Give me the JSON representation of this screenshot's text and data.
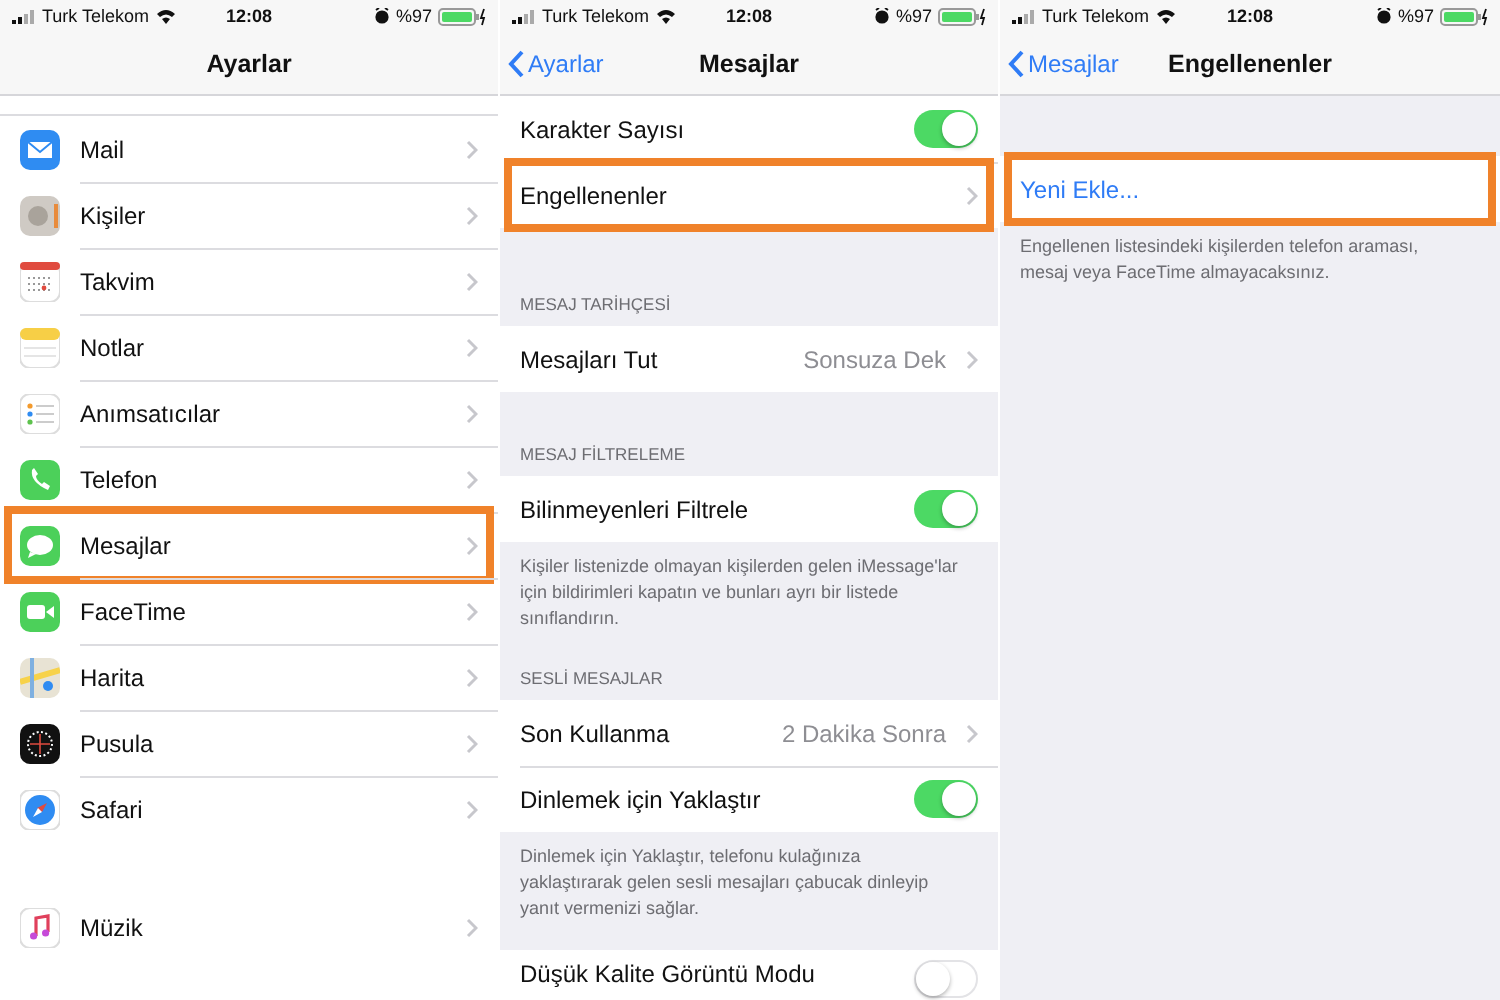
{
  "screens": [
    {
      "status_bar": {
        "carrier": "Turk Telekom",
        "time": "12:08",
        "battery": "%97"
      },
      "nav": {
        "title": "Ayarlar"
      },
      "sections": [
        {
          "rows": [
            {
              "kind": "link",
              "label": "Mail",
              "highlighted": false
            },
            {
              "kind": "link",
              "label": "Kişiler",
              "highlighted": false
            },
            {
              "kind": "link",
              "label": "Takvim",
              "highlighted": false
            },
            {
              "kind": "link",
              "label": "Notlar",
              "highlighted": false
            },
            {
              "kind": "link",
              "label": "Anımsatıcılar",
              "highlighted": false
            },
            {
              "kind": "link",
              "label": "Telefon",
              "highlighted": false
            },
            {
              "kind": "link",
              "label": "Mesajlar",
              "highlighted": true
            },
            {
              "kind": "link",
              "label": "FaceTime",
              "highlighted": false
            },
            {
              "kind": "link",
              "label": "Harita",
              "highlighted": false
            },
            {
              "kind": "link",
              "label": "Pusula",
              "highlighted": false
            },
            {
              "kind": "link",
              "label": "Safari",
              "highlighted": false
            }
          ]
        },
        {
          "rows": [
            {
              "kind": "link",
              "label": "Müzik",
              "highlighted": false
            }
          ]
        }
      ]
    },
    {
      "status_bar": {
        "carrier": "Turk Telekom",
        "time": "12:08",
        "battery": "%97"
      },
      "nav": {
        "title": "Mesajlar",
        "back": "Ayarlar"
      },
      "sections": [
        {
          "rows": [
            {
              "kind": "toggle",
              "label": "Karakter Sayısı",
              "on": true,
              "highlighted": false
            },
            {
              "kind": "link",
              "label": "Engellenenler",
              "highlighted": true
            }
          ]
        },
        {
          "header": "MESAJ TARİHÇESİ",
          "rows": [
            {
              "kind": "link",
              "label": "Mesajları Tut",
              "value": "Sonsuza Dek",
              "highlighted": false
            }
          ]
        },
        {
          "header": "MESAJ FİLTRELEME",
          "rows": [
            {
              "kind": "toggle",
              "label": "Bilinmeyenleri Filtrele",
              "on": true,
              "highlighted": false
            }
          ],
          "footer": "Kişiler listenizde olmayan kişilerden gelen iMessage'lar için bildirimleri kapatın ve bunları ayrı bir listede sınıflandırın."
        },
        {
          "header": "SESLİ MESAJLAR",
          "rows": [
            {
              "kind": "link",
              "label": "Son Kullanma",
              "value": "2 Dakika Sonra",
              "highlighted": false
            },
            {
              "kind": "toggle",
              "label": "Dinlemek için Yaklaştır",
              "on": true,
              "highlighted": false
            }
          ],
          "footer": "Dinlemek için Yaklaştır, telefonu kulağınıza yaklaştırarak gelen sesli mesajları çabucak dinleyip yanıt vermenizi sağlar."
        },
        {
          "rows": [
            {
              "kind": "toggle",
              "label": "Düşük Kalite Görüntü Modu",
              "on": false,
              "highlighted": false
            }
          ]
        }
      ]
    },
    {
      "status_bar": {
        "carrier": "Turk Telekom",
        "time": "12:08",
        "battery": "%97"
      },
      "nav": {
        "title": "Engellenenler",
        "back": "Mesajlar"
      },
      "sections": [
        {
          "rows": [
            {
              "kind": "action",
              "label": "Yeni Ekle...",
              "highlighted": true
            }
          ],
          "footer": "Engellenen listesindeki kişilerden telefon araması, mesaj veya FaceTime almayacaksınız."
        }
      ]
    }
  ]
}
